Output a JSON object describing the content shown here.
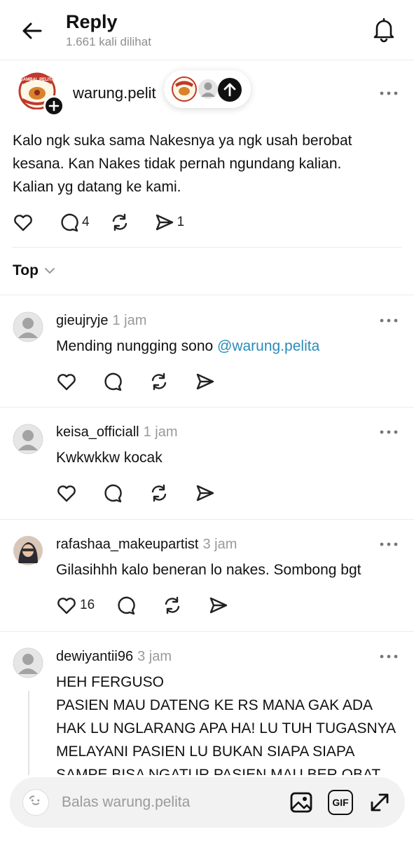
{
  "header": {
    "title": "Reply",
    "views": "1.661 kali dilihat"
  },
  "post": {
    "username": "warung.pelit",
    "text": [
      "Kalo ngk suka sama Nakesnya ya ngk usah berobat",
      "kesana. Kan Nakes tidak pernah ngundang kalian.",
      "Kalian yg datang ke kami."
    ],
    "reply_count": "4",
    "share_count": "1",
    "logo_text": "SAMBAL PELITA"
  },
  "sort": {
    "label": "Top"
  },
  "replies": [
    {
      "username": "gieujryje",
      "time": "1 jam",
      "text": "Mending nungging sono ",
      "mention": "@warung.pelita",
      "like_count": ""
    },
    {
      "username": "keisa_officiall",
      "time": "1 jam",
      "text": "Kwkwkkw kocak",
      "mention": "",
      "like_count": ""
    },
    {
      "username": "rafashaa_makeupartist",
      "time": "3 jam",
      "text": "Gilasihhh kalo beneran lo nakes. Sombong bgt",
      "mention": "",
      "like_count": "16"
    },
    {
      "username": "dewiyantii96",
      "time": "3 jam",
      "lines": [
        "HEH FERGUSO",
        "PASIEN MAU DATENG KE RS MANA GAK ADA",
        "HAK LU NGLARANG APA HA! LU TUH TUGASNYA",
        "MELAYANI PASIEN LU BUKAN SIAPA SIAPA",
        "SAMPE BISA NGATUR PASIEN MAU BER OBAT"
      ]
    }
  ],
  "reply_bar": {
    "placeholder": "Balas warung.pelita",
    "gif_label": "GIF"
  },
  "icons": {
    "back": "arrow-left-icon",
    "bell": "bell-icon",
    "like": "heart-icon",
    "comment": "comment-icon",
    "repost": "repost-icon",
    "share": "send-icon",
    "more": "more-dots-icon",
    "image": "image-icon",
    "gif": "gif-icon",
    "expand": "expand-icon"
  },
  "colors": {
    "mention": "#2a8bb8",
    "muted": "#9a9a9a",
    "divider": "#ececec",
    "logo_red": "#c0392b"
  }
}
